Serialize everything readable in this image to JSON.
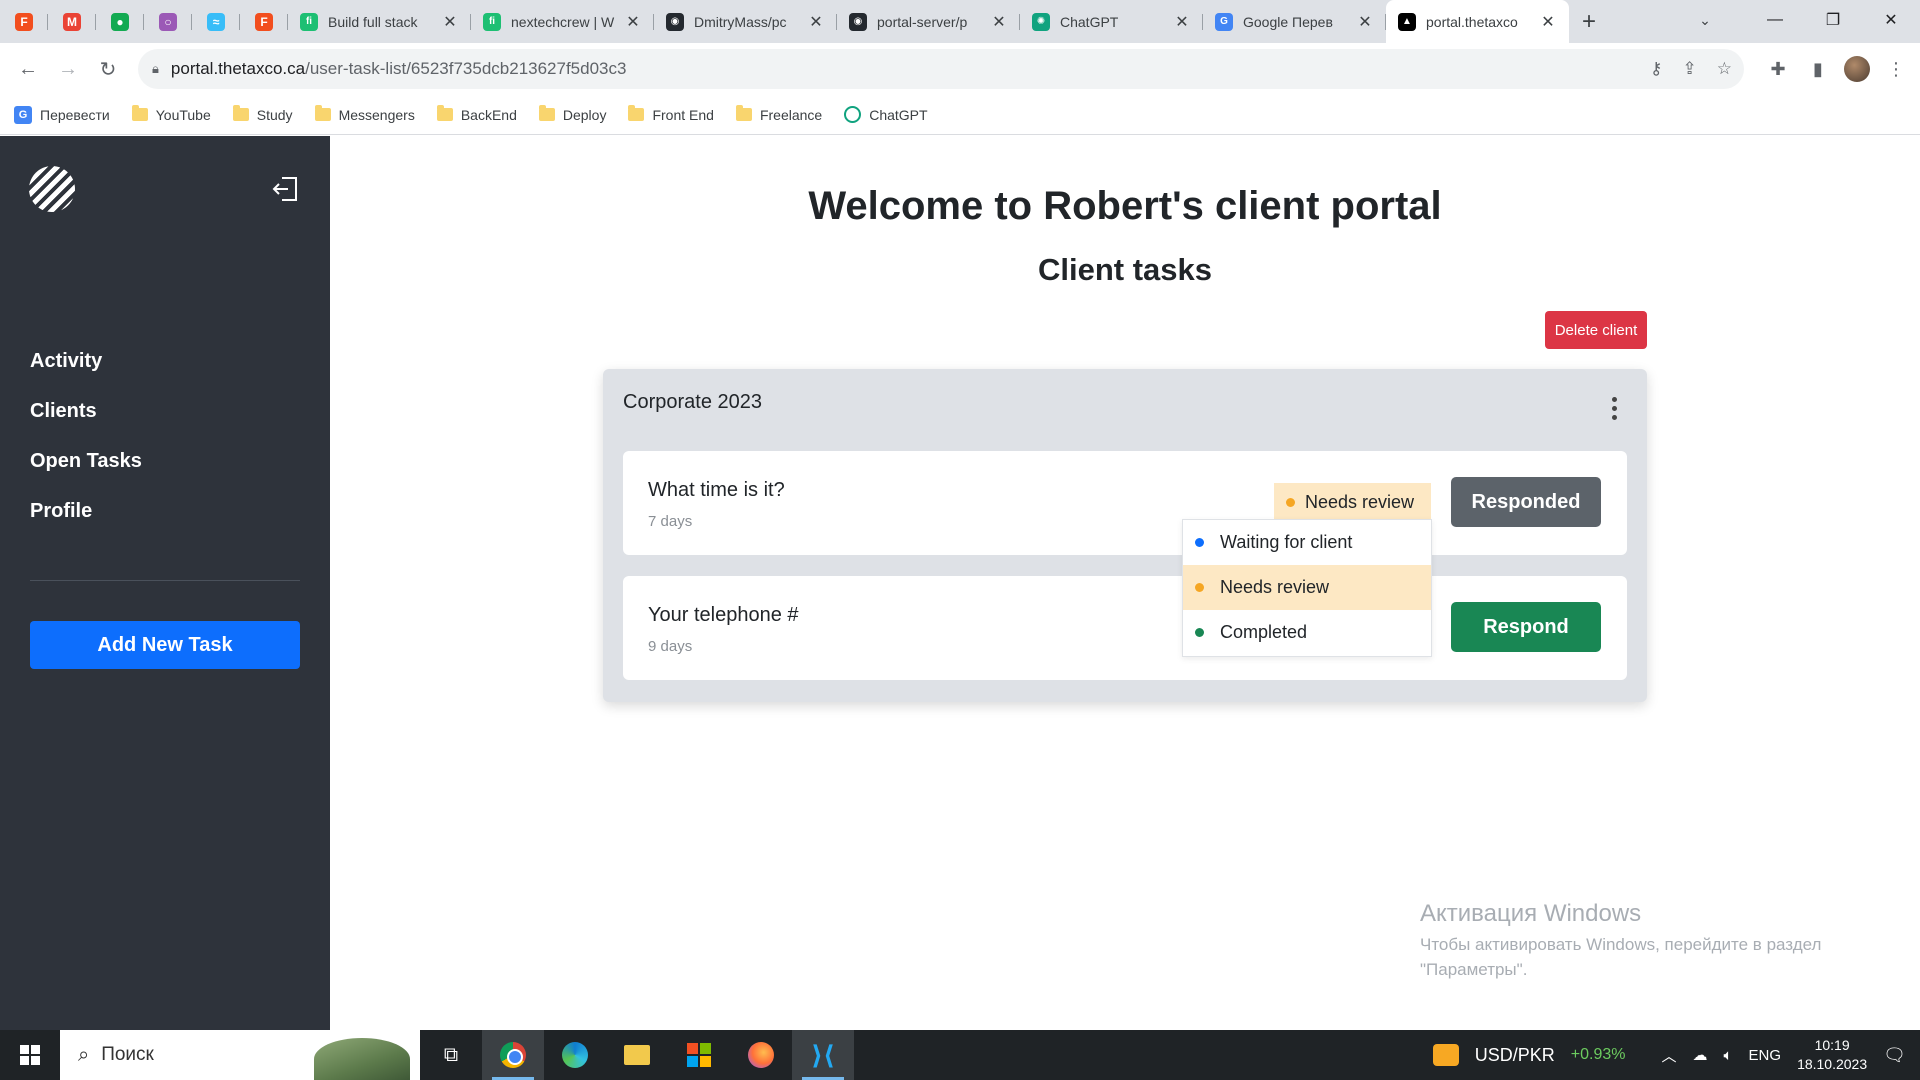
{
  "browser": {
    "pinned_tabs": [
      {
        "icon": "figma-icon",
        "color": "#f24e1e",
        "glyph": "F"
      },
      {
        "icon": "gmail-icon",
        "color": "#ea4335",
        "glyph": "M"
      },
      {
        "icon": "mongodb-icon",
        "color": "#13aa52",
        "glyph": "●"
      },
      {
        "icon": "circle-icon",
        "color": "#9b59b6",
        "glyph": "○"
      },
      {
        "icon": "tailwind-icon",
        "color": "#38bdf8",
        "glyph": "≈"
      },
      {
        "icon": "figma-icon",
        "color": "#f24e1e",
        "glyph": "F"
      }
    ],
    "tabs": [
      {
        "title": "Build full stack",
        "icon": "fiverr-icon",
        "color": "#1dbf73",
        "glyph": "fi",
        "active": false
      },
      {
        "title": "nextechcrew | W",
        "icon": "fiverr-icon",
        "color": "#1dbf73",
        "glyph": "fi",
        "active": false
      },
      {
        "title": "DmitryMass/pc",
        "icon": "github-icon",
        "color": "#24292f",
        "glyph": "◉",
        "active": false
      },
      {
        "title": "portal-server/p",
        "icon": "github-icon",
        "color": "#24292f",
        "glyph": "◉",
        "active": false
      },
      {
        "title": "ChatGPT",
        "icon": "chatgpt-icon",
        "color": "#10a37f",
        "glyph": "✺",
        "active": false
      },
      {
        "title": "Google Перев",
        "icon": "google-translate-icon",
        "color": "#4285f4",
        "glyph": "G",
        "active": false
      },
      {
        "title": "portal.thetaxco",
        "icon": "portal-icon",
        "color": "#000000",
        "glyph": "▲",
        "active": true
      }
    ],
    "url_host": "portal.thetaxco.ca",
    "url_path": "/user-task-list/6523f735dcb213627f5d03c3",
    "bookmarks": [
      {
        "label": "Перевести",
        "type": "translate"
      },
      {
        "label": "YouTube",
        "type": "folder"
      },
      {
        "label": "Study",
        "type": "folder"
      },
      {
        "label": "Messengers",
        "type": "folder"
      },
      {
        "label": "BackEnd",
        "type": "folder"
      },
      {
        "label": "Deploy",
        "type": "folder"
      },
      {
        "label": "Front End",
        "type": "folder"
      },
      {
        "label": "Freelance",
        "type": "folder"
      },
      {
        "label": "ChatGPT",
        "type": "chatgpt"
      }
    ]
  },
  "sidebar": {
    "nav": [
      "Activity",
      "Clients",
      "Open Tasks",
      "Profile"
    ],
    "add_task_label": "Add New Task"
  },
  "main": {
    "welcome": "Welcome to Robert's client portal",
    "subtitle": "Client tasks",
    "delete_label": "Delete client",
    "group_title": "Corporate 2023",
    "tasks": [
      {
        "name": "What time is it?",
        "age": "7 days",
        "status": "Needs review",
        "button": "Responded"
      },
      {
        "name": "Your telephone #",
        "age": "9 days",
        "button": "Respond"
      }
    ],
    "status_options": [
      {
        "label": "Waiting for client",
        "color": "#0d6efd"
      },
      {
        "label": "Needs review",
        "color": "#f5a623",
        "selected": true
      },
      {
        "label": "Completed",
        "color": "#198754"
      }
    ]
  },
  "watermark": {
    "title": "Активация Windows",
    "line1": "Чтобы активировать Windows, перейдите в раздел",
    "line2": "\"Параметры\"."
  },
  "taskbar": {
    "search_placeholder": "Поиск",
    "currency_label": "USD/PKR",
    "currency_change": "+0.93%",
    "lang": "ENG",
    "time": "10:19",
    "date": "18.10.2023"
  }
}
